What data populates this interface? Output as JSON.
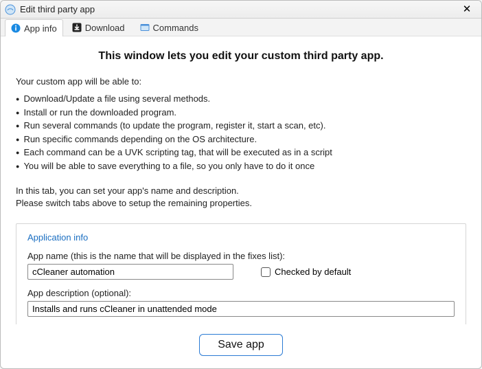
{
  "titlebar": {
    "title": "Edit third party app"
  },
  "tabs": {
    "app_info": "App info",
    "download": "Download",
    "commands": "Commands"
  },
  "main": {
    "headline": "This window lets you edit your custom third party app.",
    "intro": "Your custom app will be able to:",
    "bullets": [
      "Download/Update a file using several methods.",
      "Install or run the downloaded program.",
      "Run several commands (to update the program, register it, start a scan, etc).",
      "Run specific commands depending on the OS architecture.",
      "Each command can be a UVK scripting tag, that will be executed as in a script",
      "You will be able to save everything to a file, so you only have to do it once"
    ],
    "tab_note_line1": "In this tab, you can set your app's name and description.",
    "tab_note_line2": "Please switch tabs above to setup the remaining properties."
  },
  "fieldset": {
    "title": "Application info",
    "name_label": "App name (this is the name that will be displayed in the fixes list):",
    "name_value": "cCleaner automation",
    "checked_label": "Checked by default",
    "checked_value": false,
    "desc_label": "App description (optional):",
    "desc_value": "Installs and runs cCleaner in unattended mode"
  },
  "footer": {
    "save_label": "Save app"
  }
}
